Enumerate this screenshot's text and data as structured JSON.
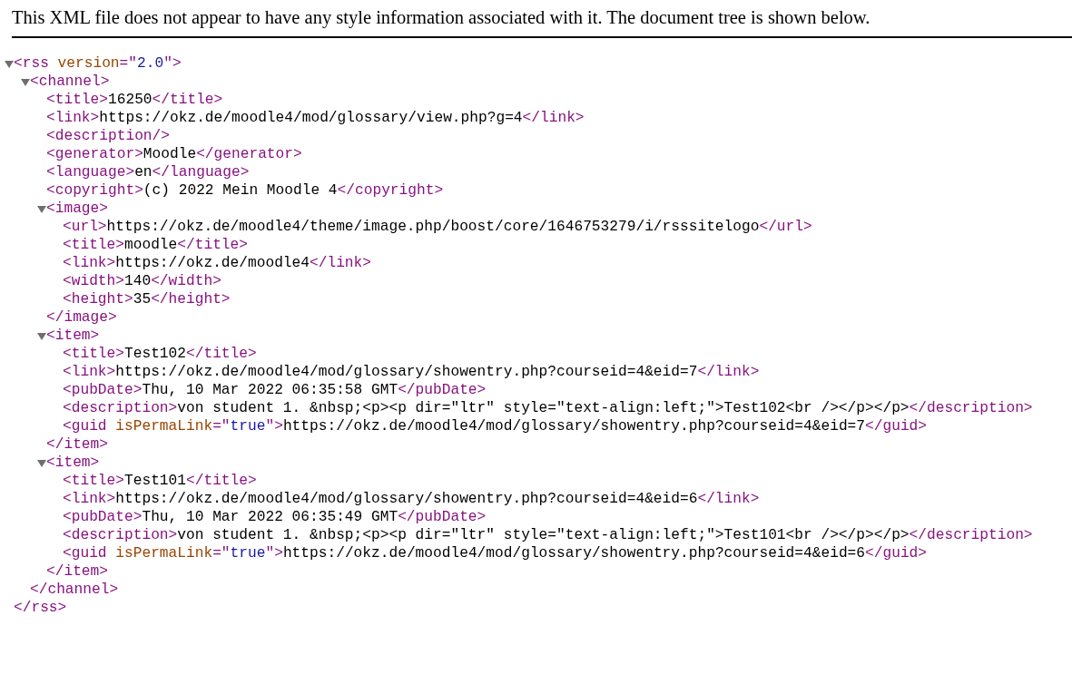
{
  "notice": "This XML file does not appear to have any style information associated with it. The document tree is shown below.",
  "tree": {
    "expanded": true,
    "line": [
      {
        "kind": "tag",
        "text": "<rss"
      },
      {
        "kind": "attr",
        "text": " version"
      },
      {
        "kind": "tag",
        "text": "=\""
      },
      {
        "kind": "value",
        "text": "2.0"
      },
      {
        "kind": "tag",
        "text": "\">"
      }
    ],
    "close": [
      {
        "kind": "tag",
        "text": "</rss>"
      }
    ],
    "children": [
      {
        "expanded": true,
        "line": [
          {
            "kind": "tag",
            "text": "<channel>"
          }
        ],
        "close": [
          {
            "kind": "tag",
            "text": "</channel>"
          }
        ],
        "children": [
          {
            "line": [
              {
                "kind": "tag",
                "text": "<title>"
              },
              {
                "kind": "text",
                "text": "16250"
              },
              {
                "kind": "tag",
                "text": "</title>"
              }
            ]
          },
          {
            "line": [
              {
                "kind": "tag",
                "text": "<link>"
              },
              {
                "kind": "text",
                "text": "https://okz.de/moodle4/mod/glossary/view.php?g=4"
              },
              {
                "kind": "tag",
                "text": "</link>"
              }
            ]
          },
          {
            "line": [
              {
                "kind": "tag",
                "text": "<description/>"
              }
            ]
          },
          {
            "line": [
              {
                "kind": "tag",
                "text": "<generator>"
              },
              {
                "kind": "text",
                "text": "Moodle"
              },
              {
                "kind": "tag",
                "text": "</generator>"
              }
            ]
          },
          {
            "line": [
              {
                "kind": "tag",
                "text": "<language>"
              },
              {
                "kind": "text",
                "text": "en"
              },
              {
                "kind": "tag",
                "text": "</language>"
              }
            ]
          },
          {
            "line": [
              {
                "kind": "tag",
                "text": "<copyright>"
              },
              {
                "kind": "text",
                "text": "(c) 2022 Mein Moodle 4"
              },
              {
                "kind": "tag",
                "text": "</copyright>"
              }
            ]
          },
          {
            "expanded": true,
            "line": [
              {
                "kind": "tag",
                "text": "<image>"
              }
            ],
            "close": [
              {
                "kind": "tag",
                "text": "</image>"
              }
            ],
            "children": [
              {
                "line": [
                  {
                    "kind": "tag",
                    "text": "<url>"
                  },
                  {
                    "kind": "text",
                    "text": "https://okz.de/moodle4/theme/image.php/boost/core/1646753279/i/rsssitelogo"
                  },
                  {
                    "kind": "tag",
                    "text": "</url>"
                  }
                ]
              },
              {
                "line": [
                  {
                    "kind": "tag",
                    "text": "<title>"
                  },
                  {
                    "kind": "text",
                    "text": "moodle"
                  },
                  {
                    "kind": "tag",
                    "text": "</title>"
                  }
                ]
              },
              {
                "line": [
                  {
                    "kind": "tag",
                    "text": "<link>"
                  },
                  {
                    "kind": "text",
                    "text": "https://okz.de/moodle4"
                  },
                  {
                    "kind": "tag",
                    "text": "</link>"
                  }
                ]
              },
              {
                "line": [
                  {
                    "kind": "tag",
                    "text": "<width>"
                  },
                  {
                    "kind": "text",
                    "text": "140"
                  },
                  {
                    "kind": "tag",
                    "text": "</width>"
                  }
                ]
              },
              {
                "line": [
                  {
                    "kind": "tag",
                    "text": "<height>"
                  },
                  {
                    "kind": "text",
                    "text": "35"
                  },
                  {
                    "kind": "tag",
                    "text": "</height>"
                  }
                ]
              }
            ]
          },
          {
            "expanded": true,
            "line": [
              {
                "kind": "tag",
                "text": "<item>"
              }
            ],
            "close": [
              {
                "kind": "tag",
                "text": "</item>"
              }
            ],
            "children": [
              {
                "line": [
                  {
                    "kind": "tag",
                    "text": "<title>"
                  },
                  {
                    "kind": "text",
                    "text": "Test102"
                  },
                  {
                    "kind": "tag",
                    "text": "</title>"
                  }
                ]
              },
              {
                "line": [
                  {
                    "kind": "tag",
                    "text": "<link>"
                  },
                  {
                    "kind": "text",
                    "text": "https://okz.de/moodle4/mod/glossary/showentry.php?courseid=4&eid=7"
                  },
                  {
                    "kind": "tag",
                    "text": "</link>"
                  }
                ]
              },
              {
                "line": [
                  {
                    "kind": "tag",
                    "text": "<pubDate>"
                  },
                  {
                    "kind": "text",
                    "text": "Thu, 10 Mar 2022 06:35:58 GMT"
                  },
                  {
                    "kind": "tag",
                    "text": "</pubDate>"
                  }
                ]
              },
              {
                "line": [
                  {
                    "kind": "tag",
                    "text": "<description>"
                  },
                  {
                    "kind": "text",
                    "text": "von student 1. &nbsp;<p><p dir=\"ltr\" style=\"text-align:left;\">Test102<br /></p></p>"
                  },
                  {
                    "kind": "tag",
                    "text": "</description>"
                  }
                ]
              },
              {
                "line": [
                  {
                    "kind": "tag",
                    "text": "<guid"
                  },
                  {
                    "kind": "attr",
                    "text": " isPermaLink"
                  },
                  {
                    "kind": "tag",
                    "text": "=\""
                  },
                  {
                    "kind": "value",
                    "text": "true"
                  },
                  {
                    "kind": "tag",
                    "text": "\">"
                  },
                  {
                    "kind": "text",
                    "text": "https://okz.de/moodle4/mod/glossary/showentry.php?courseid=4&eid=7"
                  },
                  {
                    "kind": "tag",
                    "text": "</guid>"
                  }
                ]
              }
            ]
          },
          {
            "expanded": true,
            "line": [
              {
                "kind": "tag",
                "text": "<item>"
              }
            ],
            "close": [
              {
                "kind": "tag",
                "text": "</item>"
              }
            ],
            "children": [
              {
                "line": [
                  {
                    "kind": "tag",
                    "text": "<title>"
                  },
                  {
                    "kind": "text",
                    "text": "Test101"
                  },
                  {
                    "kind": "tag",
                    "text": "</title>"
                  }
                ]
              },
              {
                "line": [
                  {
                    "kind": "tag",
                    "text": "<link>"
                  },
                  {
                    "kind": "text",
                    "text": "https://okz.de/moodle4/mod/glossary/showentry.php?courseid=4&eid=6"
                  },
                  {
                    "kind": "tag",
                    "text": "</link>"
                  }
                ]
              },
              {
                "line": [
                  {
                    "kind": "tag",
                    "text": "<pubDate>"
                  },
                  {
                    "kind": "text",
                    "text": "Thu, 10 Mar 2022 06:35:49 GMT"
                  },
                  {
                    "kind": "tag",
                    "text": "</pubDate>"
                  }
                ]
              },
              {
                "line": [
                  {
                    "kind": "tag",
                    "text": "<description>"
                  },
                  {
                    "kind": "text",
                    "text": "von student 1. &nbsp;<p><p dir=\"ltr\" style=\"text-align:left;\">Test101<br /></p></p>"
                  },
                  {
                    "kind": "tag",
                    "text": "</description>"
                  }
                ]
              },
              {
                "line": [
                  {
                    "kind": "tag",
                    "text": "<guid"
                  },
                  {
                    "kind": "attr",
                    "text": " isPermaLink"
                  },
                  {
                    "kind": "tag",
                    "text": "=\""
                  },
                  {
                    "kind": "value",
                    "text": "true"
                  },
                  {
                    "kind": "tag",
                    "text": "\">"
                  },
                  {
                    "kind": "text",
                    "text": "https://okz.de/moodle4/mod/glossary/showentry.php?courseid=4&eid=6"
                  },
                  {
                    "kind": "tag",
                    "text": "</guid>"
                  }
                ]
              }
            ]
          }
        ]
      }
    ]
  }
}
